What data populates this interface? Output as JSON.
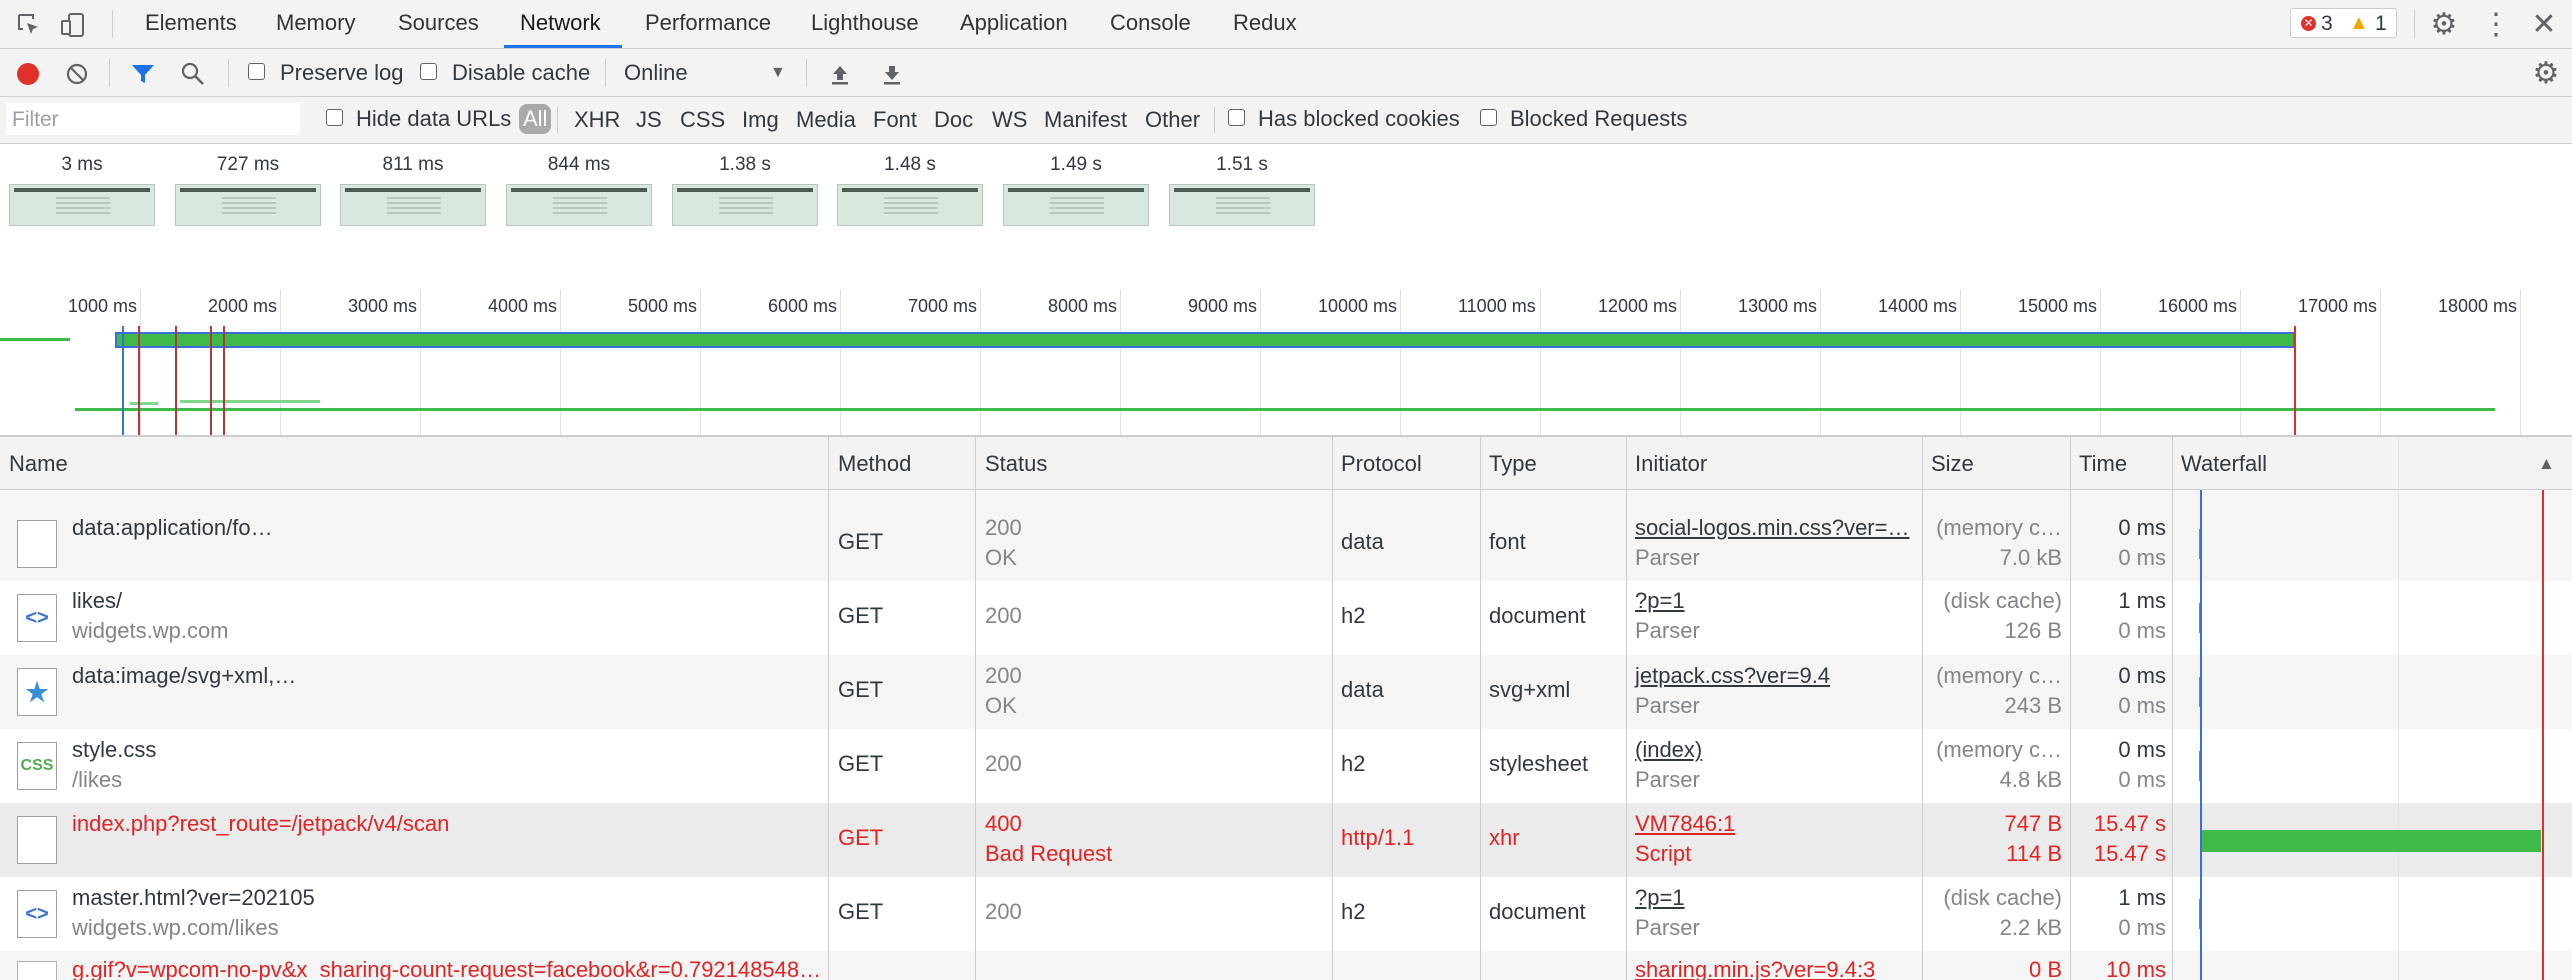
{
  "tabs": {
    "items": [
      "Elements",
      "Memory",
      "Sources",
      "Network",
      "Performance",
      "Lighthouse",
      "Application",
      "Console",
      "Redux"
    ],
    "active": "Network",
    "errors": "3",
    "warnings": "1"
  },
  "toolbar": {
    "preserve_log": "Preserve log",
    "disable_cache": "Disable cache",
    "throttling": "Online"
  },
  "filter": {
    "placeholder": "Filter",
    "hide_data_urls": "Hide data URLs",
    "types": [
      "All",
      "XHR",
      "JS",
      "CSS",
      "Img",
      "Media",
      "Font",
      "Doc",
      "WS",
      "Manifest",
      "Other"
    ],
    "selected_type": "All",
    "has_blocked_cookies": "Has blocked cookies",
    "blocked_requests": "Blocked Requests"
  },
  "filmstrip": {
    "times": [
      "3 ms",
      "727 ms",
      "811 ms",
      "844 ms",
      "1.38 s",
      "1.48 s",
      "1.49 s",
      "1.51 s"
    ]
  },
  "overview": {
    "ticks": [
      "1000 ms",
      "2000 ms",
      "3000 ms",
      "4000 ms",
      "5000 ms",
      "6000 ms",
      "7000 ms",
      "8000 ms",
      "9000 ms",
      "10000 ms",
      "11000 ms",
      "12000 ms",
      "13000 ms",
      "14000 ms",
      "15000 ms",
      "16000 ms",
      "17000 ms",
      "18000 ms"
    ]
  },
  "table": {
    "columns": [
      "Name",
      "Method",
      "Status",
      "Protocol",
      "Type",
      "Initiator",
      "Size",
      "Time",
      "Waterfall"
    ],
    "rows": [
      {
        "icon": "blank-file-icon",
        "name": "data:application/fo…",
        "path": "",
        "method": "GET",
        "status": "200",
        "status_text": "OK",
        "protocol": "data",
        "type": "font",
        "initiator": "social-logos.min.css?ver=…",
        "initiator_type": "Parser",
        "size": "(memory c…",
        "size2": "7.0 kB",
        "time": "0 ms",
        "time2": "0 ms",
        "error": false
      },
      {
        "icon": "html-doc-icon",
        "name": "likes/",
        "path": "widgets.wp.com",
        "method": "GET",
        "status": "200",
        "status_text": "",
        "protocol": "h2",
        "type": "document",
        "initiator": "?p=1",
        "initiator_type": "Parser",
        "size": "(disk cache)",
        "size2": "126 B",
        "time": "1 ms",
        "time2": "0 ms",
        "error": false
      },
      {
        "icon": "star-image-icon",
        "name": "data:image/svg+xml,…",
        "path": "",
        "method": "GET",
        "status": "200",
        "status_text": "OK",
        "protocol": "data",
        "type": "svg+xml",
        "initiator": "jetpack.css?ver=9.4",
        "initiator_type": "Parser",
        "size": "(memory c…",
        "size2": "243 B",
        "time": "0 ms",
        "time2": "0 ms",
        "error": false
      },
      {
        "icon": "css-file-icon",
        "name": "style.css",
        "path": "/likes",
        "method": "GET",
        "status": "200",
        "status_text": "",
        "protocol": "h2",
        "type": "stylesheet",
        "initiator": "(index)",
        "initiator_type": "Parser",
        "size": "(memory c…",
        "size2": "4.8 kB",
        "time": "0 ms",
        "time2": "0 ms",
        "error": false
      },
      {
        "icon": "blank-file-icon",
        "name": "index.php?rest_route=/jetpack/v4/scan",
        "path": "",
        "method": "GET",
        "status": "400",
        "status_text": "Bad Request",
        "protocol": "http/1.1",
        "type": "xhr",
        "initiator": "VM7846:1",
        "initiator_type": "Script",
        "size": "747 B",
        "size2": "114 B",
        "time": "15.47 s",
        "time2": "15.47 s",
        "error": true
      },
      {
        "icon": "html-doc-icon",
        "name": "master.html?ver=202105",
        "path": "widgets.wp.com/likes",
        "method": "GET",
        "status": "200",
        "status_text": "",
        "protocol": "h2",
        "type": "document",
        "initiator": "?p=1",
        "initiator_type": "Parser",
        "size": "(disk cache)",
        "size2": "2.2 kB",
        "time": "1 ms",
        "time2": "0 ms",
        "error": false
      },
      {
        "icon": "image-file-icon",
        "name": "g.gif?v=wpcom-no-pv&x_sharing-count-request=facebook&r=0.792148548…",
        "path": "",
        "method": "",
        "status": "",
        "status_text": "",
        "protocol": "",
        "type": "",
        "initiator": "sharing.min.js?ver=9.4:3",
        "initiator_type": "",
        "size": "0 B",
        "size2": "",
        "time": "10 ms",
        "time2": "",
        "error": true
      }
    ]
  },
  "colors": {
    "record": "#e0302a",
    "accent": "#1a73e8",
    "error_text": "#e02424",
    "waterfall_bar": "#3fba4a"
  }
}
